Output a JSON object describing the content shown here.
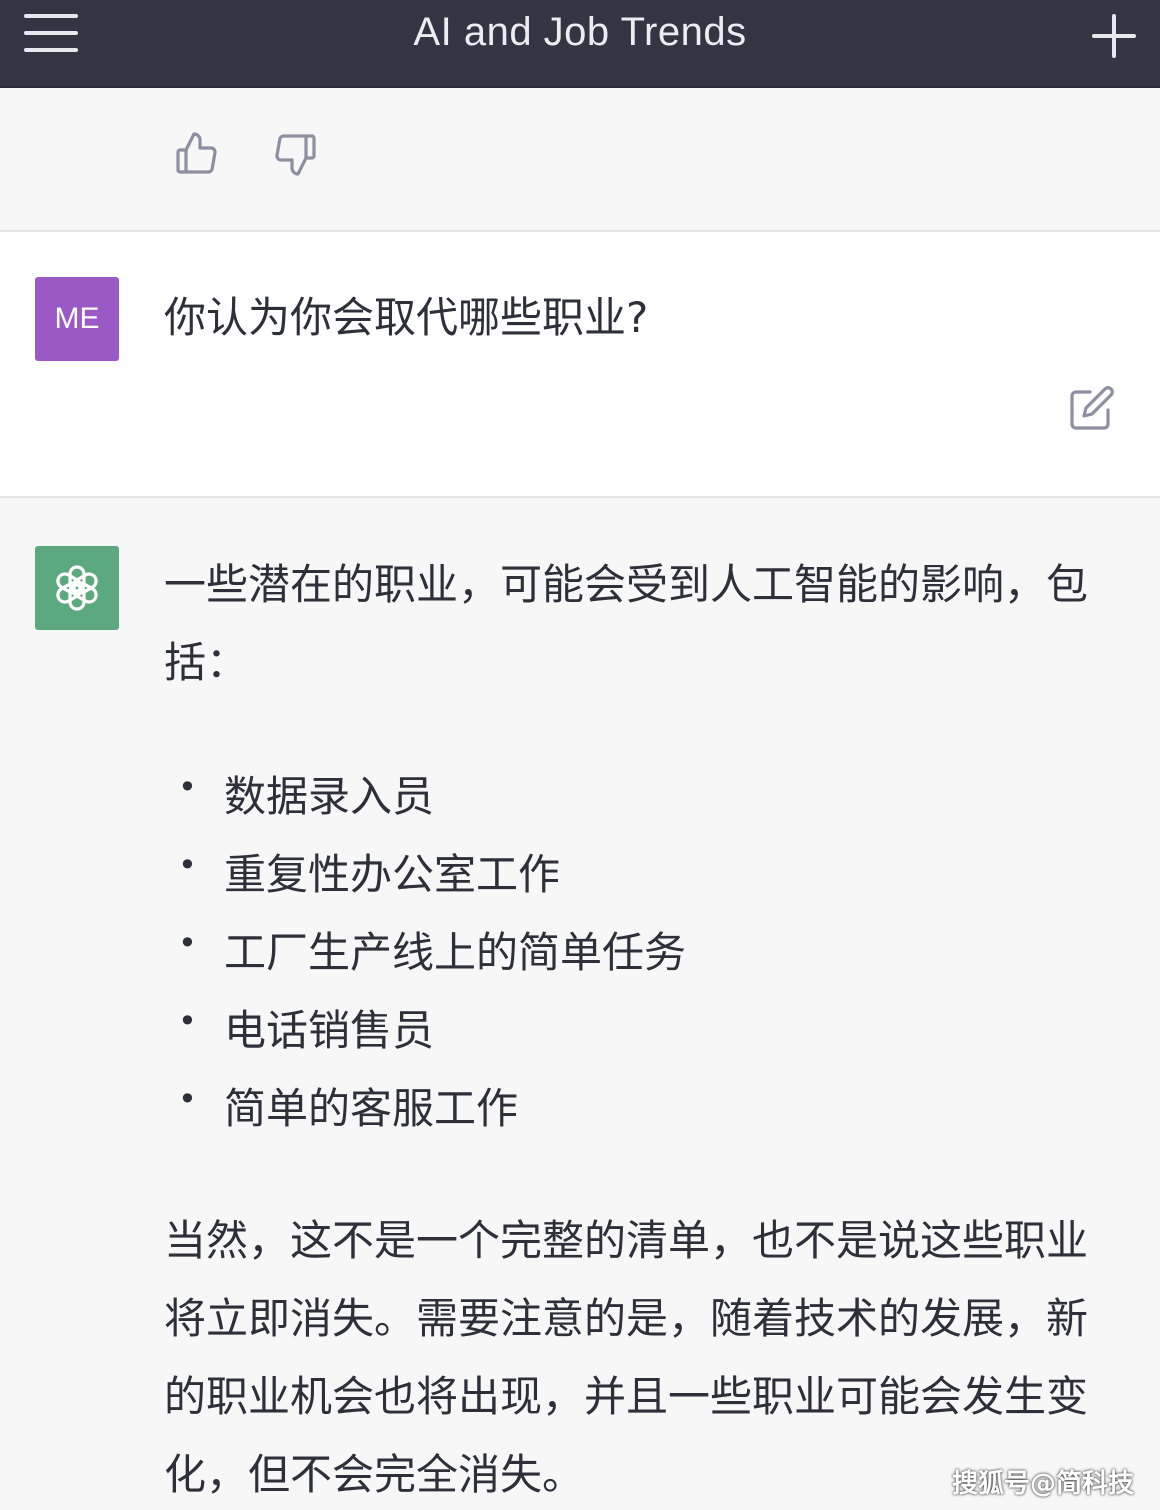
{
  "header": {
    "title": "AI and Job Trends"
  },
  "feedback": {
    "thumbs_up_icon": "thumbs-up-icon",
    "thumbs_down_icon": "thumbs-down-icon"
  },
  "user_message": {
    "avatar_label": "ME",
    "avatar_color": "#9b59c6",
    "text": "你认为你会取代哪些职业?"
  },
  "assistant_message": {
    "avatar_color": "#5ca980",
    "intro": "一些潜在的职业，可能会受到人工智能的影响，包括：",
    "bullets": [
      "数据录入员",
      "重复性办公室工作",
      "工厂生产线上的简单任务",
      "电话销售员",
      "简单的客服工作"
    ],
    "outro": "当然，这不是一个完整的清单，也不是说这些职业将立即消失。需要注意的是，随着技术的发展，新的职业机会也将出现，并且一些职业可能会发生变化，但不会完全消失。"
  },
  "watermark": "搜狐号@简科技",
  "colors": {
    "header_bg": "#343542",
    "page_bg": "#f7f7f8",
    "user_bg": "#ffffff"
  }
}
